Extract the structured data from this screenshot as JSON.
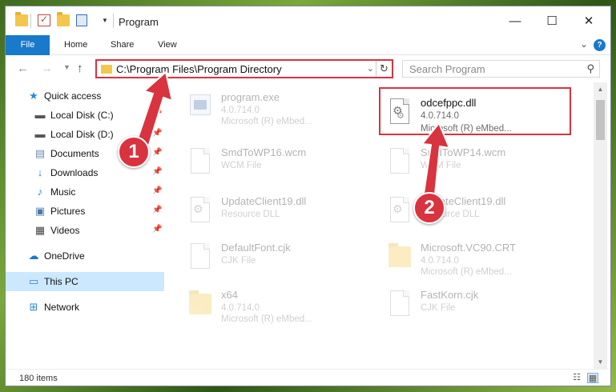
{
  "window": {
    "title": "Program"
  },
  "ribbon": {
    "tabs": [
      "File",
      "Home",
      "Share",
      "View"
    ],
    "help": "?"
  },
  "nav": {
    "address": "C:\\Program Files\\Program Directory",
    "search_placeholder": "Search Program"
  },
  "sidebar": {
    "items": [
      {
        "label": "Quick access",
        "icon": "star-icon"
      },
      {
        "label": "Local Disk (C:)",
        "icon": "drive-icon",
        "pinned": true
      },
      {
        "label": "Local Disk (D:)",
        "icon": "drive-icon",
        "pinned": true
      },
      {
        "label": "Documents",
        "icon": "documents-icon",
        "pinned": true
      },
      {
        "label": "Downloads",
        "icon": "download-icon",
        "pinned": true
      },
      {
        "label": "Music",
        "icon": "music-icon",
        "pinned": true
      },
      {
        "label": "Pictures",
        "icon": "pictures-icon",
        "pinned": true
      },
      {
        "label": "Videos",
        "icon": "videos-icon",
        "pinned": true
      },
      {
        "label": "OneDrive",
        "icon": "cloud-icon"
      },
      {
        "label": "This PC",
        "icon": "computer-icon",
        "selected": true
      },
      {
        "label": "Network",
        "icon": "network-icon"
      }
    ]
  },
  "files": [
    {
      "name": "program.exe",
      "line1": "4.0.714.0",
      "line2": "Microsoft (R) eMbed...",
      "icon": "exe-icon"
    },
    {
      "name": "odcefppc.dll",
      "line1": "4.0.714.0",
      "line2": "Microsoft (R) eMbed...",
      "icon": "dll-icon"
    },
    {
      "name": "SmdToWP16.wcm",
      "line1": "WCM File",
      "icon": "file-icon"
    },
    {
      "name": "SmdToWP14.wcm",
      "line1": "WCM File",
      "icon": "file-icon"
    },
    {
      "name": "UpdateClient19.dll",
      "line1": "Resource DLL",
      "icon": "dll-icon"
    },
    {
      "name": "UpdateClient19.dll",
      "line1": "Resource DLL",
      "icon": "dll-icon"
    },
    {
      "name": "DefaultFont.cjk",
      "line1": "CJK File",
      "icon": "file-icon"
    },
    {
      "name": "Microsoft.VC90.CRT",
      "line1": "4.0.714.0",
      "line2": "Microsoft (R) eMbed...",
      "icon": "folder-icon"
    },
    {
      "name": "x64",
      "line1": "4.0.714.0",
      "line2": "Microsoft (R) eMbed...",
      "icon": "folder-icon"
    },
    {
      "name": "FastKorn.cjk",
      "line1": "CJK File",
      "icon": "file-icon"
    }
  ],
  "status": {
    "count": "180 items"
  },
  "annotations": {
    "step1": "1",
    "step2": "2",
    "color": "#d9333f"
  }
}
